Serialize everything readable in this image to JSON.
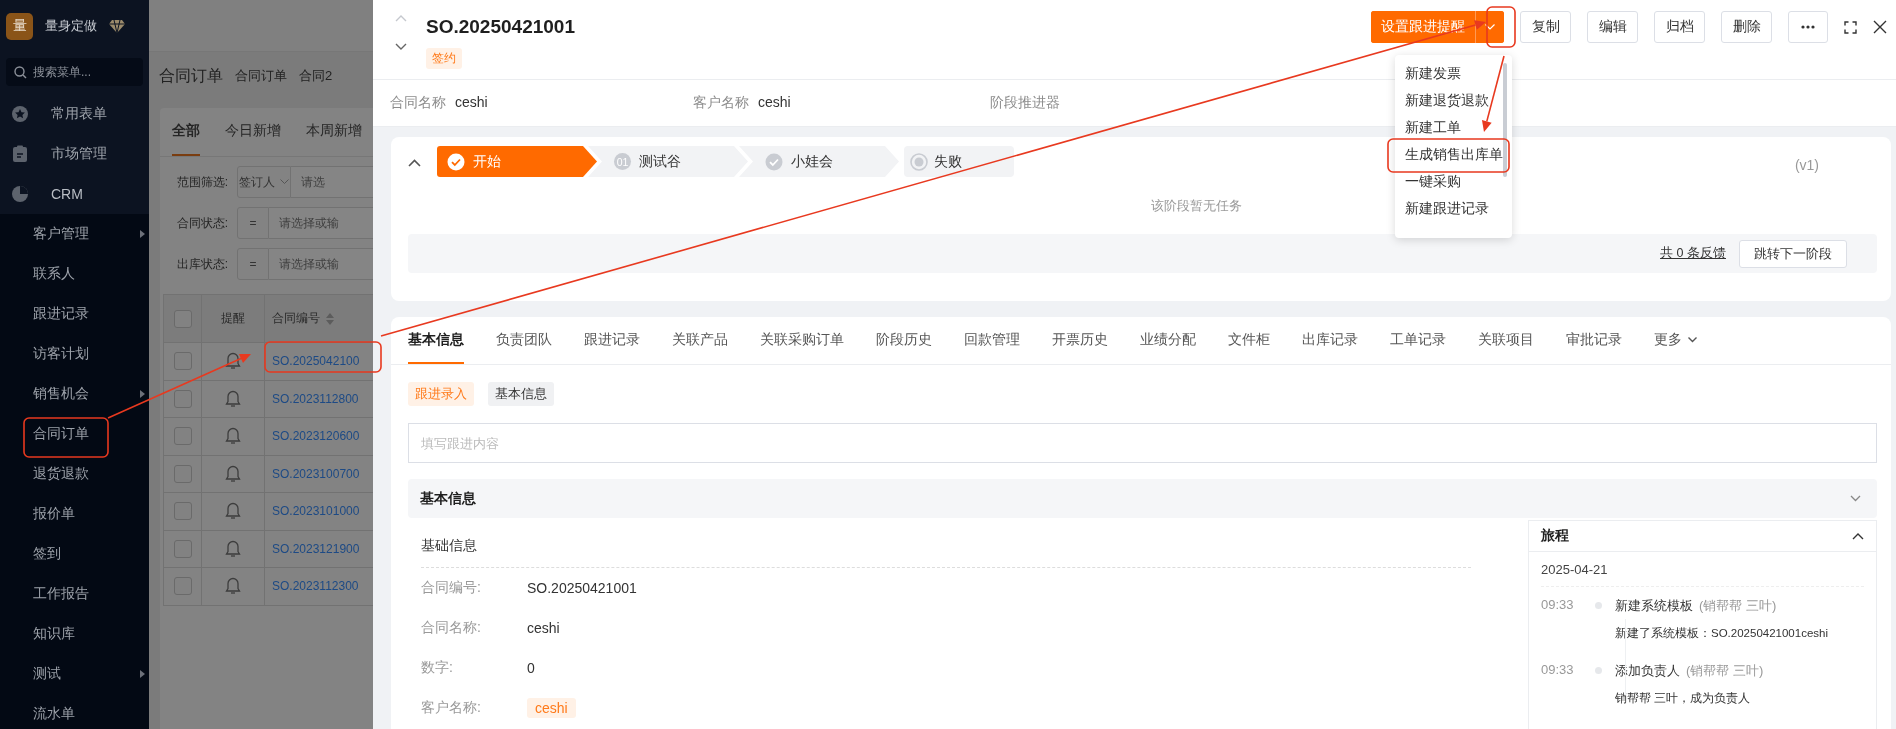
{
  "sidebar": {
    "logo_text": "量",
    "brand": "量身定做",
    "search": {
      "placeholder": "搜索菜单..."
    },
    "items": [
      {
        "label": "常用表单"
      },
      {
        "label": "市场管理"
      },
      {
        "label": "CRM",
        "expanded": true,
        "children": [
          {
            "label": "客户管理",
            "has_submenu": true
          },
          {
            "label": "联系人",
            "has_submenu": false
          },
          {
            "label": "跟进记录",
            "has_submenu": false
          },
          {
            "label": "访客计划",
            "has_submenu": false
          },
          {
            "label": "销售机会",
            "has_submenu": true
          },
          {
            "label": "合同订单",
            "has_submenu": false
          },
          {
            "label": "退货退款",
            "has_submenu": false
          },
          {
            "label": "报价单",
            "has_submenu": false
          },
          {
            "label": "签到",
            "has_submenu": false
          },
          {
            "label": "工作报告",
            "has_submenu": false
          },
          {
            "label": "知识库",
            "has_submenu": false
          },
          {
            "label": "测试",
            "has_submenu": true
          },
          {
            "label": "流水单",
            "has_submenu": false
          }
        ]
      }
    ]
  },
  "list_page": {
    "title": "合同订单",
    "breadcrumb_tabs": [
      "合同订单",
      "合同2"
    ],
    "tabs": [
      {
        "label": "全部",
        "selected": true
      },
      {
        "label": "今日新增",
        "selected": false
      },
      {
        "label": "本周新增",
        "selected": false
      }
    ],
    "filters": [
      {
        "label": "范围筛选:",
        "operator": "签订人",
        "kind": "select",
        "placeholder": "请选"
      },
      {
        "label": "合同状态:",
        "operator": "=",
        "kind": "operator",
        "placeholder": "请选择或输"
      },
      {
        "label": "出库状态:",
        "operator": "=",
        "kind": "operator",
        "placeholder": "请选择或输"
      }
    ],
    "table": {
      "columns": [
        "提醒",
        "合同编号"
      ],
      "select_all": {
        "checked": false
      },
      "rows": [
        {
          "contract_no": "SO.2025042100",
          "checked": false
        },
        {
          "contract_no": "SO.2023112800",
          "checked": false
        },
        {
          "contract_no": "SO.2023120600",
          "checked": false
        },
        {
          "contract_no": "SO.2023100700",
          "checked": false
        },
        {
          "contract_no": "SO.2023101000",
          "checked": false
        },
        {
          "contract_no": "SO.2023121900",
          "checked": false
        },
        {
          "contract_no": "SO.2023112300",
          "checked": false
        }
      ]
    }
  },
  "drawer": {
    "title": "SO.20250421001",
    "status_tag": "签约",
    "primary_action": "设置跟进提醒",
    "actions": [
      "复制",
      "编辑",
      "归档",
      "删除"
    ],
    "dropdown_menu": [
      "新建发票",
      "新建退货退款",
      "新建工单",
      "生成销售出库单",
      "一键采购",
      "新建跟进记录"
    ],
    "summary": [
      {
        "label": "合同名称",
        "value": "ceshi"
      },
      {
        "label": "客户名称",
        "value": "ceshi"
      },
      {
        "label": "阶段推进器"
      }
    ],
    "stages": {
      "steps": [
        {
          "label": "开始",
          "kind": "current"
        },
        {
          "label": "测试谷",
          "kind": "numbered",
          "number": "01"
        },
        {
          "label": "小娃会",
          "kind": "check"
        },
        {
          "label": "失败",
          "kind": "fail"
        }
      ],
      "version": "(v1)",
      "empty_text": "该阶段暂无任务",
      "feedback_link": "共 0 条反馈",
      "next_button": "跳转下一阶段"
    },
    "tabs": [
      {
        "label": "基本信息",
        "selected": true
      },
      {
        "label": "负责团队",
        "selected": false
      },
      {
        "label": "跟进记录",
        "selected": false
      },
      {
        "label": "关联产品",
        "selected": false
      },
      {
        "label": "关联采购订单",
        "selected": false
      },
      {
        "label": "阶段历史",
        "selected": false
      },
      {
        "label": "回款管理",
        "selected": false
      },
      {
        "label": "开票历史",
        "selected": false
      },
      {
        "label": "业绩分配",
        "selected": false
      },
      {
        "label": "文件柜",
        "selected": false
      },
      {
        "label": "出库记录",
        "selected": false
      },
      {
        "label": "工单记录",
        "selected": false
      },
      {
        "label": "关联项目",
        "selected": false
      },
      {
        "label": "审批记录",
        "selected": false
      },
      {
        "label": "更多",
        "selected": false,
        "kind": "more"
      }
    ],
    "entry_tabs": [
      {
        "label": "跟进录入",
        "selected": true
      },
      {
        "label": "基本信息",
        "selected": false
      }
    ],
    "followup_input": {
      "placeholder": "填写跟进内容"
    },
    "section_title": "基本信息",
    "basic_info": {
      "group_title": "基础信息",
      "fields": [
        {
          "label": "合同编号:",
          "value": "SO.20250421001",
          "kind": "text"
        },
        {
          "label": "合同名称:",
          "value": "ceshi",
          "kind": "text"
        },
        {
          "label": "数字:",
          "value": "0",
          "kind": "text"
        },
        {
          "label": "客户名称:",
          "value": "ceshi",
          "kind": "tag"
        }
      ]
    },
    "journey": {
      "title": "旅程",
      "date": "2025-04-21",
      "events": [
        {
          "time": "09:33",
          "title": "新建系统模板",
          "actor": "(销帮帮 三叶)",
          "detail": "新建了系统模板：SO.20250421001ceshi"
        },
        {
          "time": "09:33",
          "title": "添加负责人",
          "actor": "(销帮帮 三叶)",
          "detail": "销帮帮 三叶，成为负责人"
        }
      ]
    }
  }
}
